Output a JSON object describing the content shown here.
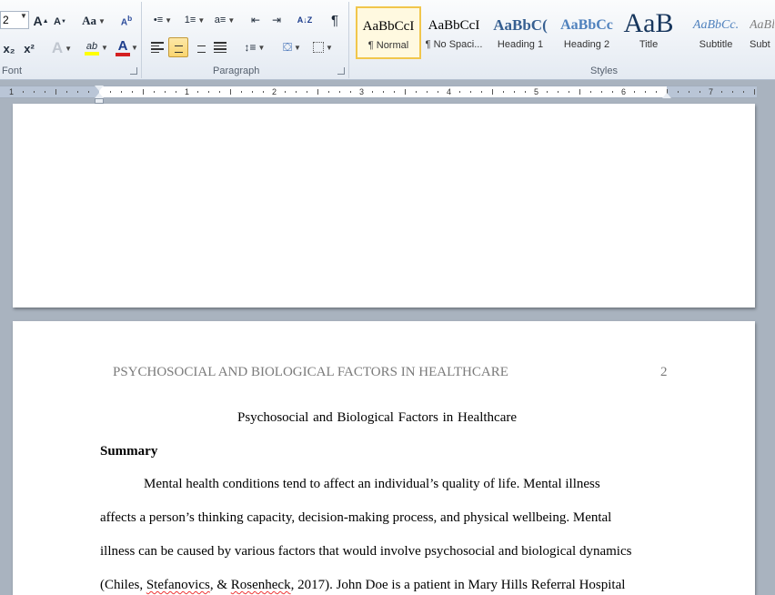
{
  "ribbon": {
    "font_group": {
      "label": "Font",
      "font_size_value": "2",
      "grow_font": "A",
      "shrink_font": "A",
      "change_case": "Aa",
      "subscript": "x₂",
      "superscript": "x²",
      "text_effects": "A",
      "highlight": "ab",
      "font_color": "A"
    },
    "paragraph_group": {
      "label": "Paragraph",
      "sort": "A↓Z",
      "show_marks": "¶"
    },
    "styles_group": {
      "label": "Styles",
      "tiles": [
        {
          "preview": "AaBbCcI",
          "name": "¶ Normal"
        },
        {
          "preview": "AaBbCcI",
          "name": "¶ No Spaci..."
        },
        {
          "preview": "AaBbC(",
          "name": "Heading 1"
        },
        {
          "preview": "AaBbCc",
          "name": "Heading 2"
        },
        {
          "preview": "AaB",
          "name": "Title"
        },
        {
          "preview": "AaBbCc.",
          "name": "Subtitle"
        },
        {
          "preview": "AaBl",
          "name": "Subt"
        }
      ]
    }
  },
  "ruler": {
    "numbers": [
      "1",
      "1",
      "2",
      "3",
      "4",
      "5",
      "6",
      "7"
    ]
  },
  "document": {
    "header": "PSYCHOSOCIAL AND BIOLOGICAL FACTORS IN HEALTHCARE",
    "page_number": "2",
    "title": "Psychosocial and Biological Factors in Healthcare",
    "heading": "Summary",
    "body_lines": [
      "Mental health conditions tend to affect an individual’s quality of life. Mental illness",
      "affects a person’s thinking capacity, decision-making process, and physical wellbeing. Mental",
      "illness can be caused by various factors that would involve psychosocial and biological dynamics"
    ],
    "last_line": {
      "open": "(Chiles, ",
      "name1": "Stefanovics",
      "mid": ", & ",
      "name2": "Rosenheck",
      "close": ", 2017). John Doe is a patient in Mary Hills Referral Hospital"
    }
  },
  "colors": {
    "highlight": "#ffff00",
    "font_color": "#d42020",
    "accent_tile_border": "#f1c64c",
    "heading_blue": "#365f91"
  }
}
